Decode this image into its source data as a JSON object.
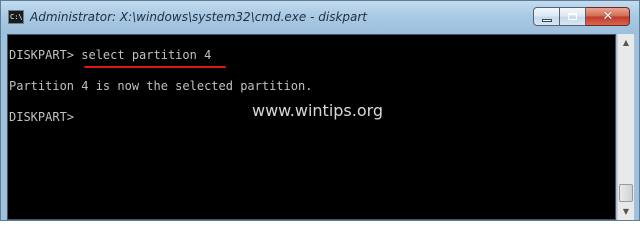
{
  "window": {
    "title": "Administrator: X:\\windows\\system32\\cmd.exe - diskpart",
    "app_icon": "C:\\",
    "icon_name": "command-prompt-icon"
  },
  "caption_buttons": {
    "close_glyph": "✕"
  },
  "console": {
    "lines": [
      {
        "prompt": "DISKPART> ",
        "command": "select partition 4"
      },
      {
        "text": "Partition 4 is now the selected partition."
      },
      {
        "prompt": "DISKPART> "
      }
    ],
    "highlight_color": "#e0141b",
    "text_color": "#c0c0c0",
    "background": "#000000"
  },
  "watermark": "www.wintips.org",
  "scrollbar": {
    "up_glyph": "▲",
    "down_glyph": "▼"
  }
}
